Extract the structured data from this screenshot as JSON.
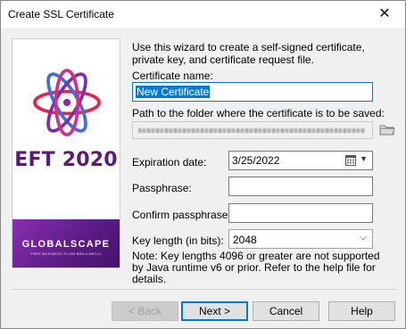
{
  "window": {
    "title": "Create SSL Certificate"
  },
  "banner": {
    "product": "EFT 2020",
    "brand": "GLOBALSCAPE",
    "tagline": "FREE BUSINESS FLOW BRILLIANTLY",
    "colors": {
      "product_text": "#5b1a73",
      "band": "#6a2290"
    }
  },
  "form": {
    "intro": "Use this wizard to create a self-signed certificate, private key, and certificate request file.",
    "cert_name_label": "Certificate name:",
    "cert_name_value": "New Certificate",
    "path_label": "Path to the folder where the certificate is to be saved:",
    "expiration_label": "Expiration date:",
    "expiration_value": "3/25/2022",
    "passphrase_label": "Passphrase:",
    "passphrase_value": "",
    "confirm_label": "Confirm passphrase:",
    "confirm_value": "",
    "key_length_label": "Key length (in bits):",
    "key_length_value": "2048",
    "note": "Note:  Key lengths 4096 or greater are not supported by Java runtime v6 or prior. Refer to the help file for details."
  },
  "buttons": {
    "back": "< Back",
    "next": "Next >",
    "cancel": "Cancel",
    "help": "Help"
  },
  "icons": {
    "close": "close-icon",
    "folder": "folder-icon",
    "calendar": "calendar-icon",
    "dropdown": "chevron-down-icon",
    "logo": "atom-logo-icon"
  }
}
